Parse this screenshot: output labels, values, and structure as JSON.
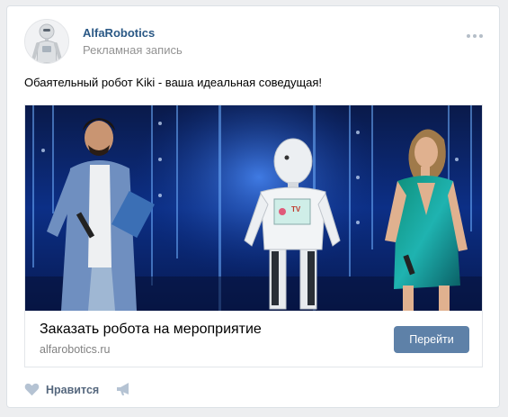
{
  "post": {
    "author": "AlfaRobotics",
    "subtitle": "Рекламная запись",
    "text": "Обаятельный робот Kiki - ваша идеальная соведущая!",
    "more_icon": "more-horizontal-icon"
  },
  "attachment": {
    "title": "Заказать робота на мероприятие",
    "domain": "alfarobotics.ru",
    "button_label": "Перейти",
    "button_color": "#5e81a8",
    "robot_screen_text": "TV"
  },
  "actions": {
    "like_label": "Нравится",
    "like_icon": "heart-icon",
    "share_icon": "megaphone-icon"
  },
  "colors": {
    "link": "#2a5885",
    "muted": "#939393",
    "background": "#edeef0"
  }
}
